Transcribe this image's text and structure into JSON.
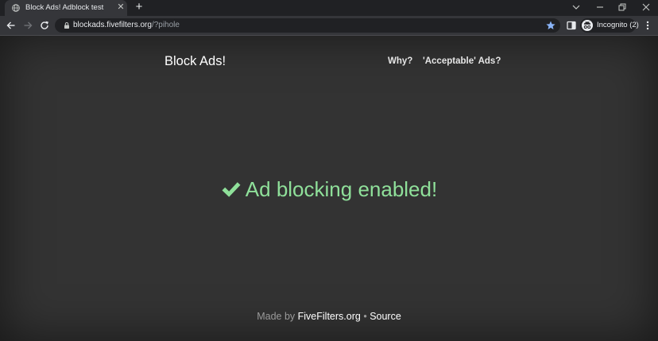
{
  "browser": {
    "tab_title": "Block Ads! Adblock test",
    "tab_close_glyph": "✕",
    "new_tab_glyph": "+",
    "url_host": "blockads.fivefilters.org",
    "url_path": "/?pihole",
    "incognito_label": "Incognito (2)",
    "icons": {
      "favicon": "globe-icon",
      "back": "arrow-left-icon",
      "forward": "arrow-right-icon",
      "reload": "reload-icon",
      "lock": "lock-icon",
      "bookmark": "star-icon",
      "side_panel": "side-panel-icon",
      "menu": "kebab-menu-icon"
    },
    "colors": {
      "tab_strip": "#202124",
      "toolbar": "#35363a",
      "star": "#8ab4f8"
    }
  },
  "page": {
    "site_title": "Block Ads!",
    "nav": {
      "why": "Why?",
      "acceptable_ads": "'Acceptable' Ads?"
    },
    "status_text": "Ad blocking enabled!",
    "status_icon": "checkmark-icon",
    "footer": {
      "made_by": "Made by",
      "fivefilters": "FiveFilters.org",
      "bullet": "•",
      "source": "Source"
    },
    "colors": {
      "background": "#333333",
      "status": "#8fe09a"
    }
  }
}
